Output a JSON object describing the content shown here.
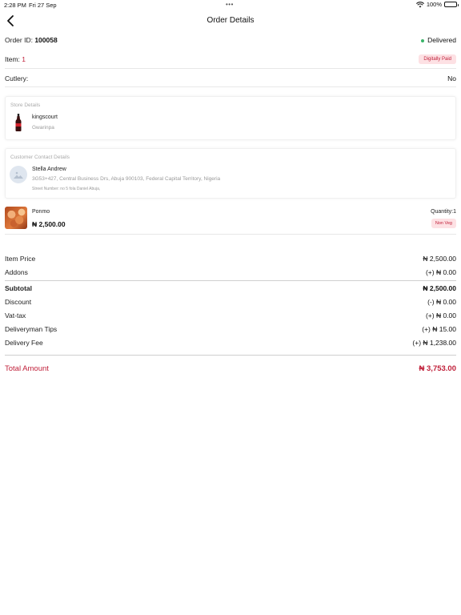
{
  "status_bar": {
    "time": "2:28 PM",
    "date": "Fri 27 Sep",
    "battery": "100%",
    "multitask_dots": "•••"
  },
  "header": {
    "title": "Order Details"
  },
  "order": {
    "id_label": "Order ID:",
    "id_value": "100058",
    "status": "Delivered",
    "item_label": "Item:",
    "item_count": "1",
    "payment_badge": "Digitally Paid",
    "cutlery_label": "Cutlery:",
    "cutlery_value": "No"
  },
  "store": {
    "section_title": "Store Details",
    "name": "kingscourt",
    "location": "Gwarinpa"
  },
  "customer": {
    "section_title": "Customer Contact Details",
    "name": "Stella Andrew",
    "address": "3G53+427, Central Business Drs, Abuja 900103, Federal Capital Territory, Nigeria",
    "street": "Street Number: no 5 fola Daniel Abuja,"
  },
  "item": {
    "name": "Ponmo",
    "price": "₦ 2,500.00",
    "quantity": "Quantity:1",
    "tag": "Non Veg"
  },
  "summary": {
    "item_price_label": "Item Price",
    "item_price": "₦ 2,500.00",
    "addons_label": "Addons",
    "addons": "(+) ₦ 0.00",
    "subtotal_label": "Subtotal",
    "subtotal": "₦ 2,500.00",
    "discount_label": "Discount",
    "discount": "(-) ₦ 0.00",
    "vat_label": "Vat-tax",
    "vat": "(+) ₦ 0.00",
    "tips_label": "Deliveryman Tips",
    "tips": "(+) ₦ 15.00",
    "delivery_label": "Delivery Fee",
    "delivery": "(+) ₦ 1,238.00",
    "total_label": "Total Amount",
    "total": "₦ 3,753.00"
  },
  "colors": {
    "accent": "#c0203a",
    "badge_bg": "#fde1e4",
    "delivered_dot": "#3ab469"
  }
}
